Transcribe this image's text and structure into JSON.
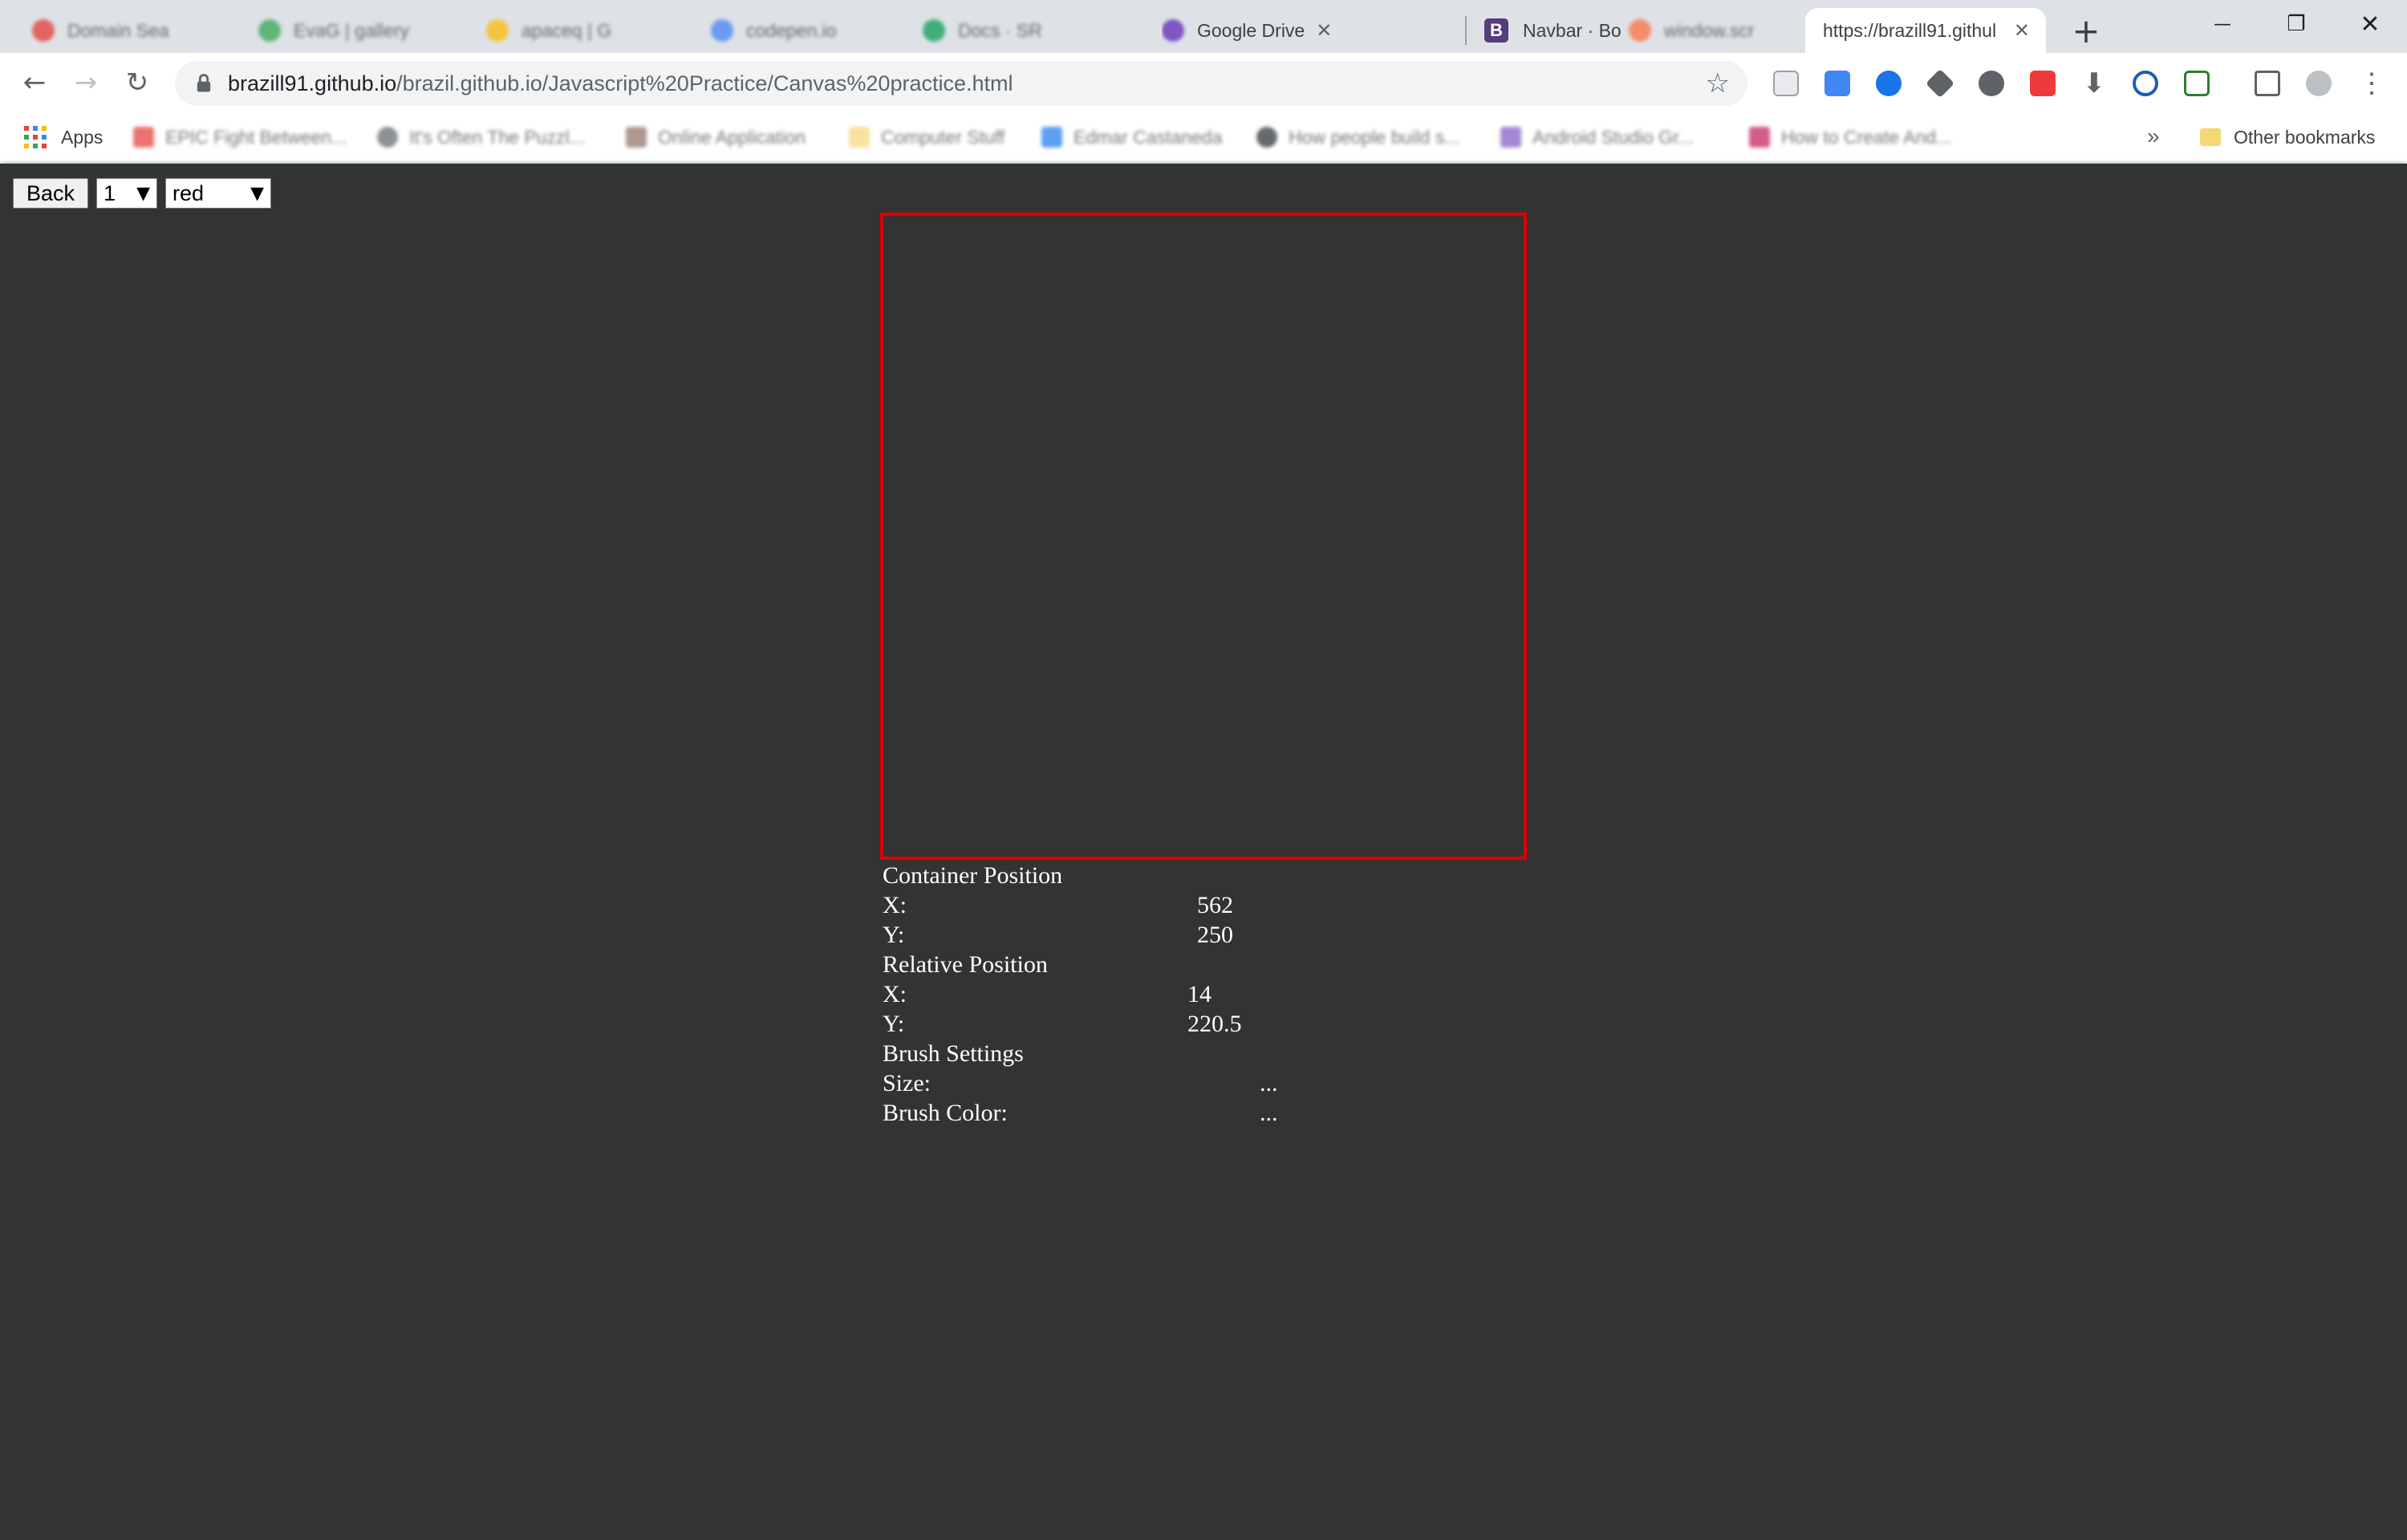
{
  "browser": {
    "tabs": [
      {
        "title": "Domain Sea",
        "favicon_color": "#e53935",
        "blurred": true
      },
      {
        "title": "EvaG | gallery",
        "favicon_color": "#34a853",
        "blurred": true
      },
      {
        "title": "apaceq | G",
        "favicon_color": "#fbbc04",
        "blurred": true
      },
      {
        "title": "codepen.io",
        "favicon_color": "#4285f4",
        "blurred": true
      },
      {
        "title": "Docs · SR",
        "favicon_color": "#0f9d58",
        "blurred": true
      },
      {
        "title": "Google Drive",
        "favicon_color": "#7e57c2",
        "blurred": false
      },
      {
        "title": "Navbar · Bo",
        "favicon_color": "#563d7c",
        "blurred": false
      },
      {
        "title": "window.scr",
        "favicon_color": "#ff7043",
        "blurred": true
      }
    ],
    "active_tab": {
      "title": "https://brazill91.githul",
      "close": "✕"
    },
    "new_tab": "+",
    "window_controls": {
      "minimize": "—",
      "restore": "❐",
      "close": "✕"
    },
    "url": {
      "host": "brazill91.github.io",
      "path": "/brazil.github.io/Javascript%20Practice/Canvas%20practice.html"
    },
    "bookmarks": [
      {
        "label": "EPIC Fight Between...",
        "icon_color": "#e53935"
      },
      {
        "label": "It's Often The Puzzl...",
        "icon_color": "#5f6368"
      },
      {
        "label": "Online Application",
        "icon_color": "#8d6e63"
      },
      {
        "label": "Computer Stuff",
        "icon_color": "#f5d776"
      },
      {
        "label": "Edmar Castaneda",
        "icon_color": "#1877f2"
      },
      {
        "label": "How people build s...",
        "icon_color": "#24292e"
      },
      {
        "label": "Android Studio Gr...",
        "icon_color": "#7e57c2"
      },
      {
        "label": "How to Create And...",
        "icon_color": "#c2185b"
      }
    ],
    "apps_label": "Apps",
    "overflow_label": "»",
    "other_bookmarks": "Other bookmarks"
  },
  "page": {
    "back_button": "Back",
    "size_select": {
      "value": "1",
      "arrow": "▼"
    },
    "color_select": {
      "value": "red",
      "arrow": "▼"
    },
    "canvas": {
      "border_color": "#e00000"
    },
    "info": {
      "container_heading": "Container Position",
      "container_x_label": "X:",
      "container_x": "562",
      "container_y_label": "Y:",
      "container_y": "250",
      "relative_heading": "Relative Position",
      "relative_x_label": "X:",
      "relative_x": "14",
      "relative_y_label": "Y:",
      "relative_y": "220.5",
      "brush_heading": "Brush Settings",
      "size_label": "Size:",
      "size_value": "...",
      "color_label": "Brush Color:",
      "color_value": "..."
    }
  }
}
